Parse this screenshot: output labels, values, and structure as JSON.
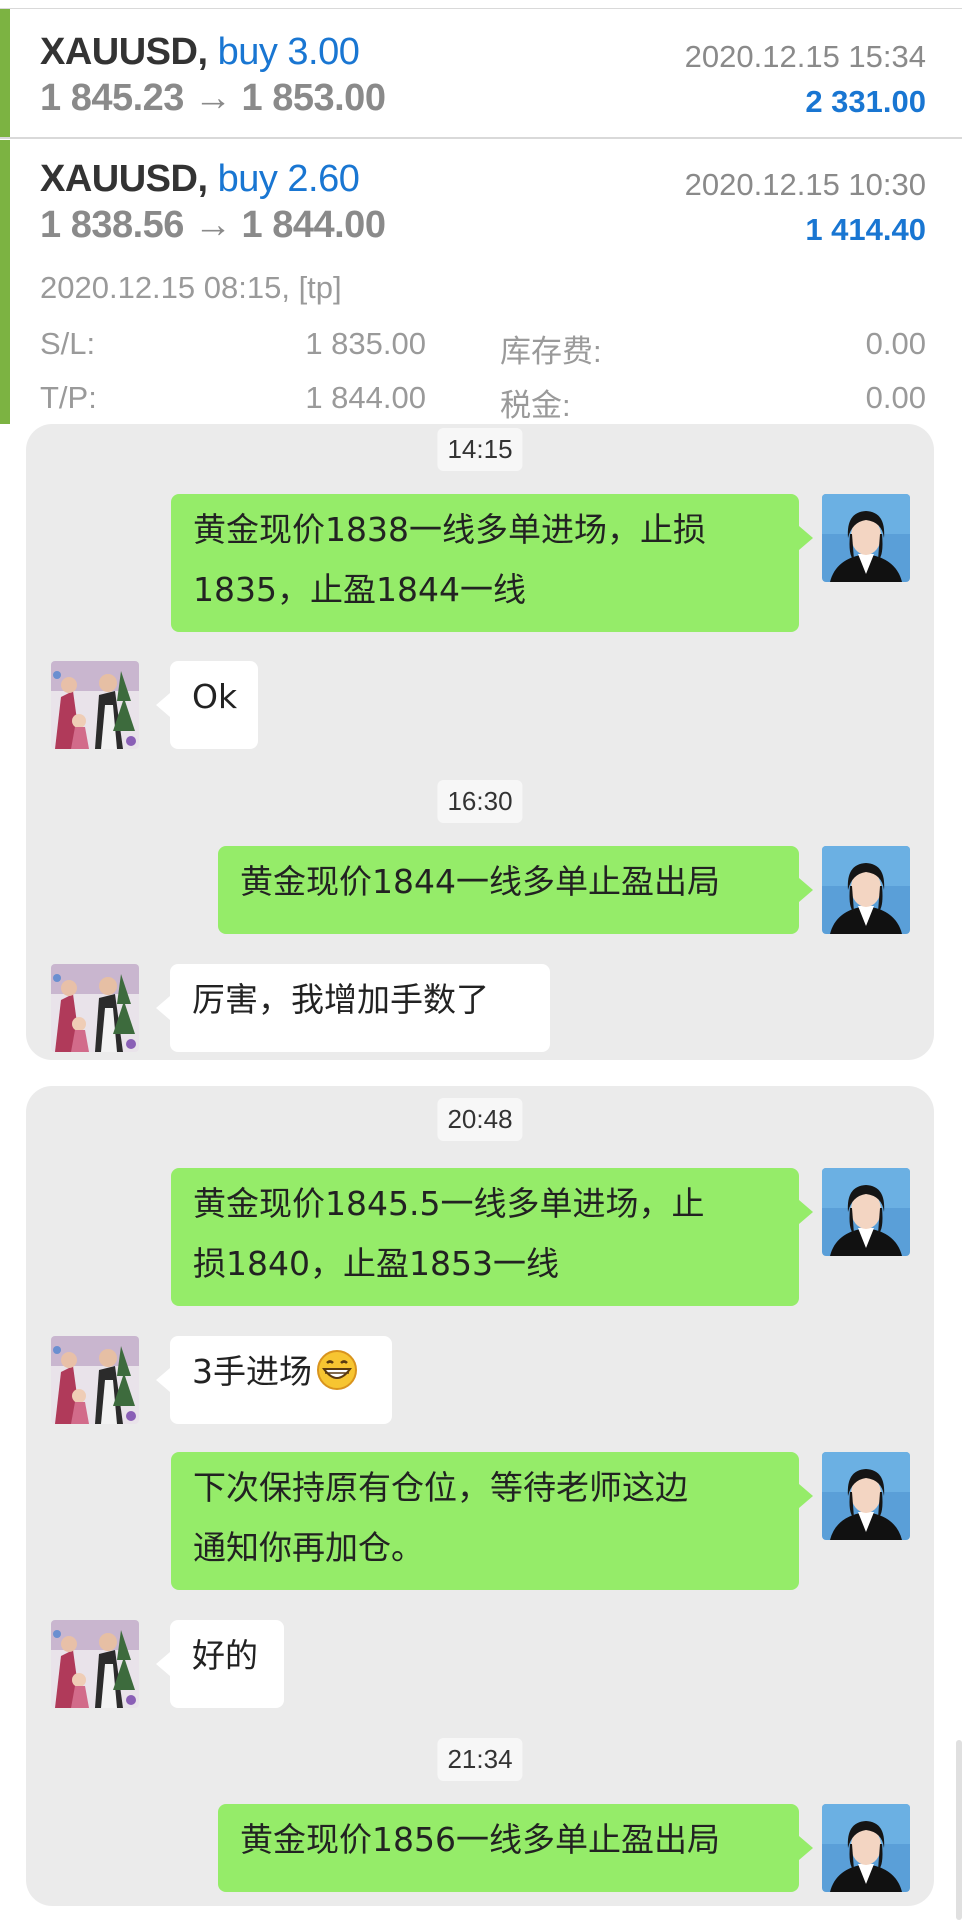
{
  "trades": [
    {
      "symbol": "XAUUSD,",
      "direction": "buy 3.00",
      "prices": "1 845.23 → 1 853.00",
      "time": "2020.12.15 15:34",
      "profit": "2 331.00"
    },
    {
      "symbol": "XAUUSD,",
      "direction": "buy 2.60",
      "prices": "1 838.56 → 1 844.00",
      "time": "2020.12.15 10:30",
      "profit": "1 414.40",
      "open_info": "2020.12.15 08:15, [tp]",
      "details": [
        {
          "label": "S/L:",
          "value": "1 835.00",
          "label2": "库存费:",
          "value2": "0.00"
        },
        {
          "label": "T/P:",
          "value": "1 844.00",
          "label2": "税金:",
          "value2": "0.00"
        }
      ]
    }
  ],
  "chat": {
    "panel1": {
      "times": [
        "14:15",
        "16:30"
      ],
      "messages": [
        {
          "from": "me",
          "lines": [
            "黄金现价1838一线多单进场，止损",
            "1835，止盈1844一线"
          ]
        },
        {
          "from": "other",
          "lines": [
            "Ok"
          ]
        },
        {
          "from": "me",
          "lines": [
            "黄金现价1844一线多单止盈出局"
          ]
        },
        {
          "from": "other",
          "lines": [
            "厉害，我增加手数了"
          ]
        }
      ]
    },
    "panel2": {
      "times": [
        "20:48",
        "21:34"
      ],
      "messages": [
        {
          "from": "me",
          "lines": [
            "黄金现价1845.5一线多单进场，止",
            "损1840，止盈1853一线"
          ]
        },
        {
          "from": "other",
          "lines": [
            "3手进场"
          ],
          "emoji": "grinning-face-icon"
        },
        {
          "from": "me",
          "lines": [
            "下次保持原有仓位，等待老师这边",
            "通知你再加仓。"
          ]
        },
        {
          "from": "other",
          "lines": [
            "好的"
          ]
        },
        {
          "from": "me",
          "lines": [
            "黄金现价1856一线多单止盈出局"
          ]
        }
      ]
    }
  },
  "colors": {
    "accent_green_bar": "#7cb342",
    "blue": "#1976d2",
    "my_bubble": "#95ec69",
    "other_bubble": "#ffffff",
    "chat_bg": "#ebebeb"
  }
}
